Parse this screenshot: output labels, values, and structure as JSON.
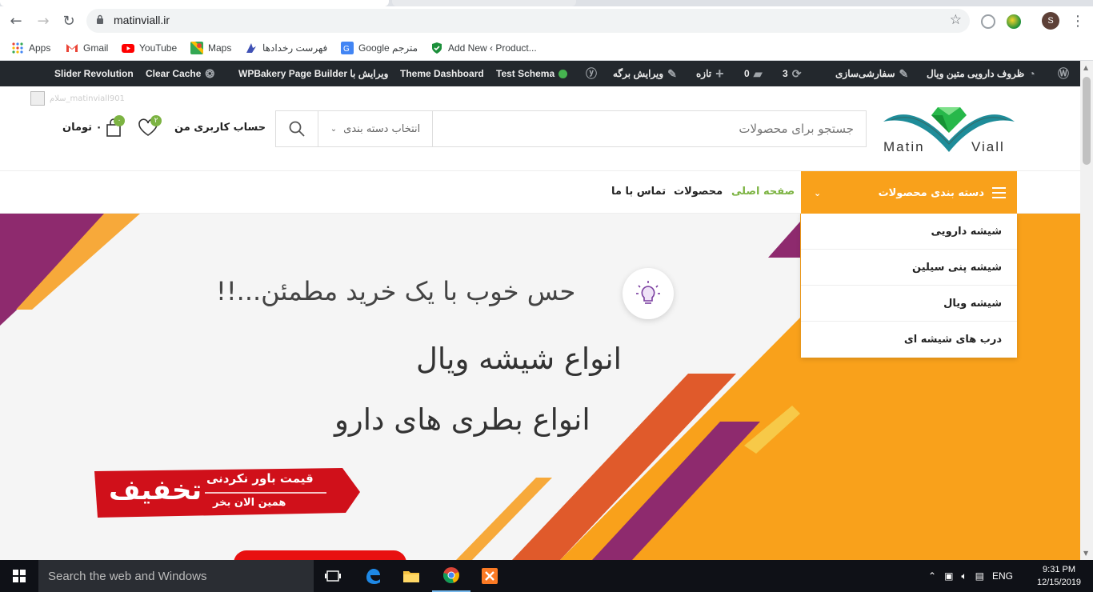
{
  "browser": {
    "url": "matinviall.ir",
    "profile_initial": "S",
    "bookmarks": [
      {
        "label": "Apps",
        "icon": "apps-grid-icon"
      },
      {
        "label": "Gmail",
        "icon": "gmail-icon"
      },
      {
        "label": "YouTube",
        "icon": "youtube-icon"
      },
      {
        "label": "Maps",
        "icon": "maps-icon"
      },
      {
        "label": "فهرست رخدادها",
        "icon": "events-icon"
      },
      {
        "label": "Google مترجم",
        "icon": "translate-icon"
      },
      {
        "label": "Add New ‹ Product...",
        "icon": "shield-check-icon"
      }
    ]
  },
  "adminbar": {
    "site_name": "ظروف دارویی متین ویال",
    "customize": "سفارشی‌سازی",
    "updates_count": "3",
    "comments_count": "0",
    "new": "تازه",
    "edit_page": "ویرایش برگه",
    "test_schema": "Test Schema",
    "theme_dashboard": "Theme Dashboard",
    "wpbakery": "WPBakery Page Builder ویرایش با",
    "clear_cache": "Clear Cache",
    "slider_revolution": "Slider Revolution"
  },
  "greeting": "سلام_matinviall901",
  "header": {
    "logo_left": "Matin",
    "logo_right": "Viall",
    "search_placeholder": "جستجو برای محصولات",
    "category_select": "انتخاب دسته بندی",
    "account": "حساب کاربری من",
    "wishlist_count": "۲",
    "cart_count": "۰",
    "cart_total": "۰ تومان"
  },
  "nav": {
    "categories_button": "دسته بندی محصولات",
    "links": [
      "صفحه اصلی",
      "محصولات",
      "تماس با ما"
    ],
    "active_color": "#7cb342"
  },
  "category_menu": [
    "شیشه دارویی",
    "شیشه پنی سیلین",
    "شیشه ویال",
    "درب های شیشه ای"
  ],
  "hero": {
    "tagline": "حس خوب با یک خرید مطمئن...!!",
    "line1": "انواع شیشه ویال",
    "line2": "انواع بطری های دارو",
    "ribbon_big": "تخفیف",
    "ribbon_line1": "قیمت باور نکردنی",
    "ribbon_line2": "همین الان بخر"
  },
  "taskbar": {
    "search_placeholder": "Search the web and Windows",
    "language": "ENG",
    "time": "9:31 PM",
    "date": "12/15/2019"
  },
  "colors": {
    "accent_orange": "#f9a11b",
    "accent_purple": "#8e2a6e",
    "accent_green": "#7cb342",
    "admin_bar": "#23282d"
  }
}
